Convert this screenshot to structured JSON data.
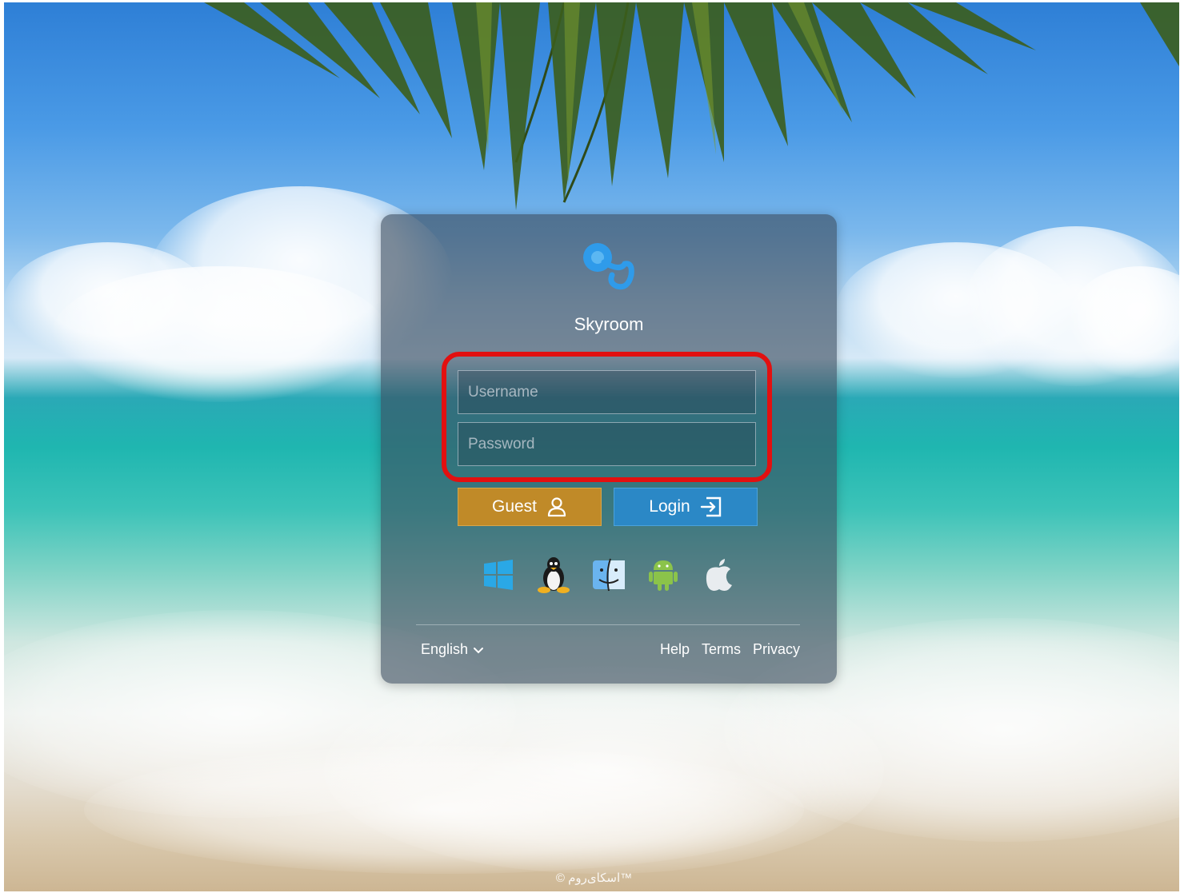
{
  "app": {
    "name": "Skyroom"
  },
  "login_form": {
    "username": {
      "placeholder": "Username",
      "value": ""
    },
    "password": {
      "placeholder": "Password",
      "value": ""
    },
    "guest_label": "Guest",
    "login_label": "Login"
  },
  "platforms": [
    "windows-icon",
    "linux-icon",
    "macos-finder-icon",
    "android-icon",
    "apple-icon"
  ],
  "footer_bar": {
    "language": "English",
    "links": {
      "help": "Help",
      "terms": "Terms",
      "privacy": "Privacy"
    }
  },
  "copyright": "© اسکای‌روم™",
  "colors": {
    "guest_button": "#c08a28",
    "login_button": "#2b88c6",
    "highlight_border": "#e21010",
    "logo_blue": "#2f9bea"
  }
}
